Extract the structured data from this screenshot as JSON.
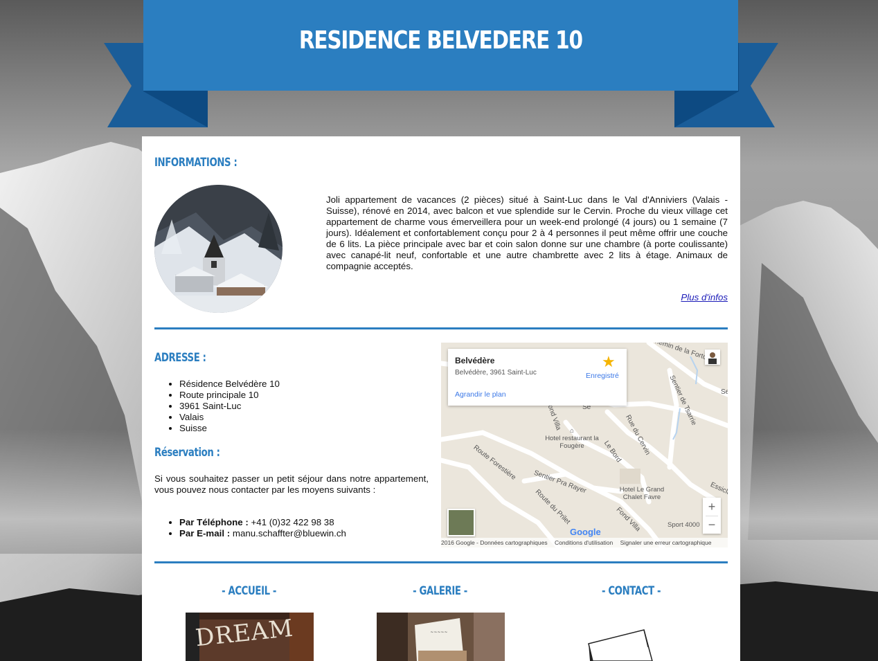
{
  "banner": {
    "title": "RESIDENCE BELVEDERE 10"
  },
  "informations": {
    "title": "INFORMATIONS :",
    "image_alt": "Église de Saint-Luc sous la neige",
    "text": "Joli appartement de vacances (2 pièces) situé à Saint-Luc dans le Val d'Anniviers (Valais - Suisse), rénové en 2014, avec balcon et vue splendide sur le Cervin. Proche du vieux village cet appartement de charme vous émerveillera pour un week-end prolongé (4 jours) ou 1 semaine (7 jours). Idéalement et confortablement conçu pour 2 à 4 personnes il peut même offrir une couche de 6 lits. La pièce principale avec bar et coin salon donne sur une chambre (à porte coulissante) avec canapé-lit neuf, confortable et une autre chambrette avec 2 lits à étage. Animaux de compagnie acceptés.",
    "more_link": "Plus d'infos"
  },
  "adresse": {
    "title": "ADRESSE :",
    "lines": [
      "Résidence Belvédère 10",
      "Route principale 10",
      "3961 Saint-Luc",
      "Valais",
      "Suisse"
    ]
  },
  "reservation": {
    "title": "Réservation :",
    "text": "Si vous souhaitez passer un petit séjour dans notre appartement, vous pouvez nous contacter par les moyens suivants :",
    "phone_label": "Par Téléphone :",
    "phone": "+41 (0)32 422 98 38",
    "email_label": "Par E-mail :",
    "email": "manu.schaffter@bluewin.ch"
  },
  "map": {
    "place_name": "Belvédère",
    "place_address": "Belvédère, 3961 Saint-Luc",
    "saved_label": "Enregistré",
    "enlarge_label": "Agrandir le plan",
    "streets": {
      "s1": "Chemin de la Fortouna",
      "s2": "Sentier de Tsarrie",
      "s3": "Rue du Cervin",
      "s4": "Le Bord",
      "s5": "Route Forestière",
      "s6": "Sentier Pra Rayer",
      "s7": "Route du Prilet",
      "s8": "Fond Villa",
      "s9": "Essicla",
      "s10": "Fond Villa",
      "s11": "Se",
      "s12": "Se"
    },
    "poi1": "Hotel restaurant la Fougère",
    "poi2": "Hotel Le Grand Chalet Favre",
    "poi3": "Sport 4000",
    "zoom_in": "+",
    "zoom_out": "−",
    "google": "Google",
    "footer_data": "2016 Google - Données cartographiques",
    "footer_terms": "Conditions d'utilisation",
    "footer_report": "Signaler une erreur cartographique"
  },
  "nav": {
    "home": "- ACCUEIL -",
    "gallery": "- GALERIE -",
    "contact": "- CONTACT -",
    "home_image_text": "DREAM"
  },
  "colors": {
    "accent": "#2b7ec0",
    "ribbon_dark": "#1a5d99",
    "link": "#1a1ab8"
  }
}
